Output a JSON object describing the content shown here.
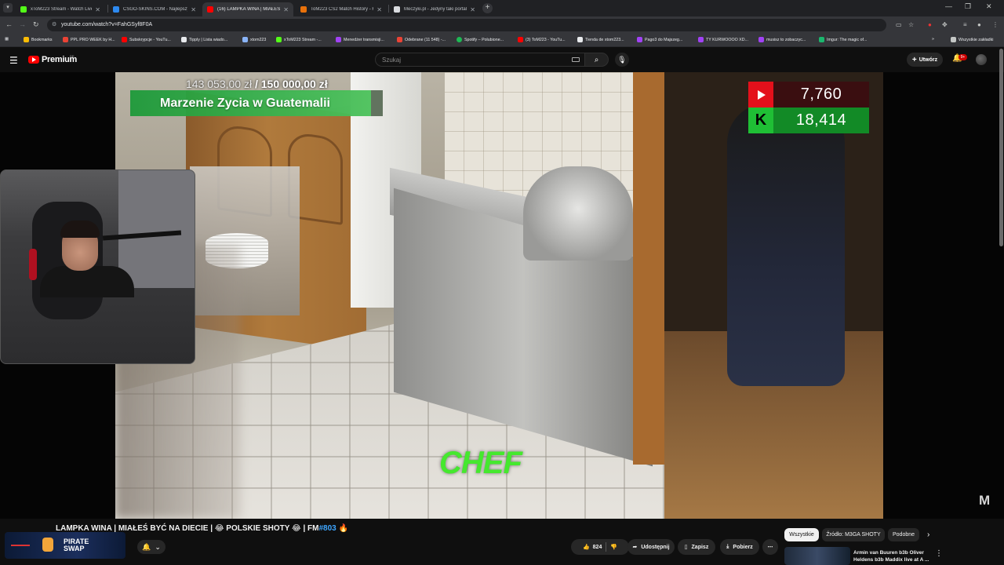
{
  "browser": {
    "tabs": [
      {
        "title": "xToM223 Stream - Watch Live",
        "favicon_color": "#53fc18",
        "active": false
      },
      {
        "title": "CSGO-SKINS.COM - Najlepszy",
        "favicon_color": "#2d89ef",
        "active": false
      },
      {
        "title": "(16) LAMPKA WINA | MIAŁEŚ B",
        "favicon_color": "#ff0000",
        "active": true
      },
      {
        "title": "ToM223 CS2 Match History - F",
        "favicon_color": "#e8710a",
        "active": false
      },
      {
        "title": "Meczyki.pl - Jedyny taki portal",
        "favicon_color": "#dadce0",
        "active": false
      }
    ],
    "url": "youtube.com/watch?v=FahGSyf8F0A",
    "bookmarks": [
      {
        "label": "Bookmarks",
        "color": "#fbbc04"
      },
      {
        "label": "PPL PRO WEEK by H...",
        "color": "#ea4335"
      },
      {
        "label": "Subskrypcje - YouTu...",
        "color": "#ff0000"
      },
      {
        "label": "Tipply | Lista wiado...",
        "color": "#e8eaed"
      },
      {
        "label": "xtom223",
        "color": "#8ab4f8"
      },
      {
        "label": "xToM223 Stream -...",
        "color": "#53fc18"
      },
      {
        "label": "Menedżer transmisji...",
        "color": "#a142f4"
      },
      {
        "label": "Odebrane (11 548) -...",
        "color": "#ea4335"
      },
      {
        "label": "Spotify – Polubione...",
        "color": "#1db954"
      },
      {
        "label": "(3) ToM223 - YouTu...",
        "color": "#ff0000"
      },
      {
        "label": "Tienda de xtom223...",
        "color": "#e8eaed"
      },
      {
        "label": "Pago3 do Majszeg...",
        "color": "#a142f4"
      },
      {
        "label": "TY KURWOOOO XD...",
        "color": "#a142f4"
      },
      {
        "label": "musisz to zobaczyc...",
        "color": "#a142f4"
      },
      {
        "label": "Imgur: The magic of...",
        "color": "#1bb76e"
      }
    ],
    "other_bookmarks": "Wszystkie zakładki"
  },
  "youtube": {
    "brand": "Premium",
    "region": "DE",
    "search_placeholder": "Szukaj",
    "create_label": "Utwórz",
    "notification_count": "9+"
  },
  "video": {
    "goal_amount": "143 053,00 zł",
    "goal_target": "/ 150 000,00 zł",
    "goal_progress": 0.954,
    "goal_title": "Marzenie Zycia w Guatemalii",
    "youtube_viewers": "7,760",
    "kick_viewers": "18,414",
    "overlay_text": "CHEF",
    "watermark": "M",
    "title_prefix": "LAMPKA WINA | MIAŁEŚ BYĆ NA DIECIE | 😂 POLSKIE SHOTY 😂 | FM",
    "title_hashtag": "#803",
    "title_suffix": "🔥"
  },
  "sponsor": {
    "line1": "PIRATE",
    "line2": "SWAP"
  },
  "actions": {
    "likes": "824",
    "share": "Udostępnij",
    "save": "Zapisz",
    "download": "Pobierz"
  },
  "chips": [
    {
      "label": "Wszystkie",
      "active": true
    },
    {
      "label": "Źródło: M3GA SHOTY",
      "active": false
    },
    {
      "label": "Podobne",
      "active": false
    }
  ],
  "recommendation": {
    "title": "Armin van Buuren b3b Oliver Heldens b3b Maddix live at A ..."
  }
}
